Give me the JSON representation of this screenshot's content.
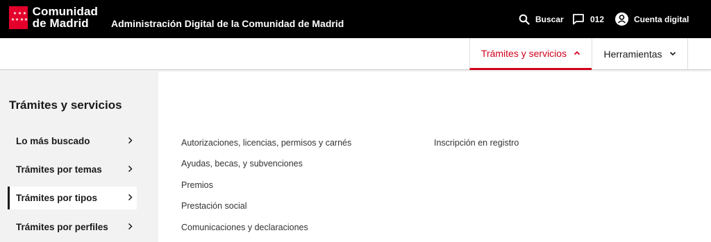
{
  "header": {
    "logo": {
      "line1": "Comunidad",
      "line2": "de Madrid"
    },
    "site_title": "Administración Digital de la Comunidad de Madrid",
    "tools": {
      "search_label": "Buscar",
      "phone_label": "012",
      "account_label": "Cuenta digital"
    }
  },
  "nav": {
    "tabs": [
      {
        "label": "Trámites y servicios",
        "active": true
      },
      {
        "label": "Herramientas",
        "active": false
      }
    ]
  },
  "sidebar": {
    "title": "Trámites y servicios",
    "items": [
      {
        "label": "Lo más buscado"
      },
      {
        "label": "Trámites por temas"
      },
      {
        "label": "Trámites por tipos",
        "active": true
      },
      {
        "label": "Trámites por perfiles"
      }
    ]
  },
  "content": {
    "col1": [
      "Autorizaciones, licencias, permisos y carnés",
      "Ayudas, becas, y subvenciones",
      "Premios",
      "Prestación social",
      "Comunicaciones y declaraciones"
    ],
    "col2": [
      "Inscripción en registro"
    ]
  },
  "colors": {
    "brand_red": "#e4002b",
    "accent_red": "#d0021b",
    "topbar": "#000000",
    "sidebar_bg": "#f2f2f2"
  }
}
